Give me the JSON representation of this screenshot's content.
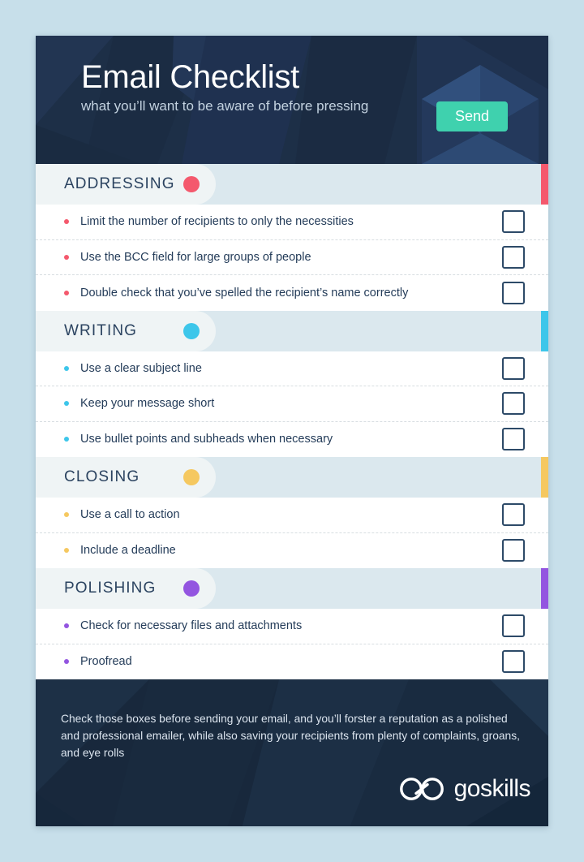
{
  "page": {
    "background_color": "#c7dfea"
  },
  "header": {
    "title": "Email Checklist",
    "subtitle": "what you’ll want to be aware of before pressing",
    "send_button_label": "Send",
    "background_color": "#1d2f47",
    "send_button_color": "#3fd1ae",
    "envelope_icon": "open-envelope-icon"
  },
  "sections": [
    {
      "id": "addressing",
      "title": "ADDRESSING",
      "color": "#f4596d",
      "items": [
        {
          "label": "Limit the number of recipients to only the necessities",
          "checked": false
        },
        {
          "label": "Use the BCC field for large groups of people",
          "checked": false
        },
        {
          "label": "Double check that you’ve spelled the recipient’s name correctly",
          "checked": false
        }
      ]
    },
    {
      "id": "writing",
      "title": "WRITING",
      "color": "#3dc6ea",
      "items": [
        {
          "label": "Use a clear subject line",
          "checked": false
        },
        {
          "label": "Keep your message short",
          "checked": false
        },
        {
          "label": "Use bullet points and subheads when necessary",
          "checked": false
        }
      ]
    },
    {
      "id": "closing",
      "title": "CLOSING",
      "color": "#f5c860",
      "items": [
        {
          "label": "Use a call to action",
          "checked": false
        },
        {
          "label": "Include a deadline",
          "checked": false
        }
      ]
    },
    {
      "id": "polishing",
      "title": "POLISHING",
      "color": "#9355e0",
      "items": [
        {
          "label": "Check for necessary files and attachments",
          "checked": false
        },
        {
          "label": "Proofread",
          "checked": false
        }
      ]
    }
  ],
  "footer": {
    "text": "Check those boxes before sending your email, and you’ll forster a reputation as a polished and professional emailer, while also saving your recipients from plenty of complaints, groans, and eye rolls",
    "logo_mark": "infinity-loop-icon",
    "logo_word_1": "go",
    "logo_word_2": "skills",
    "background_color": "#18283c"
  }
}
